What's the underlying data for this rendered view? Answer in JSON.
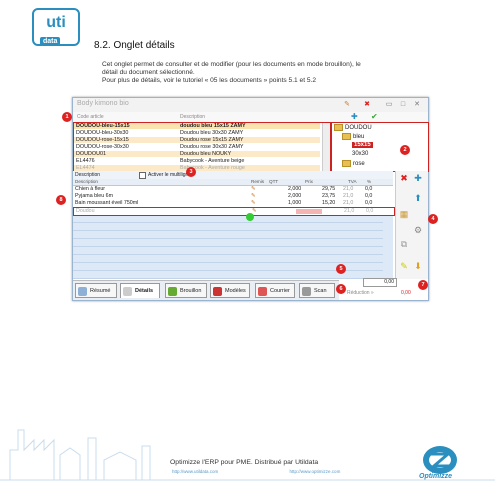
{
  "logo": {
    "main": "uti",
    "sub": "data"
  },
  "doc": {
    "section_title": "8.2. Onglet détails",
    "intro": [
      "Cet onglet permet de consulter et de modifier (pour les documents en mode brouillon), le",
      "détail du document sélectionné.",
      "Pour plus de détails, voir le tutoriel « 05 les documents » points 5.1 et 5.2"
    ]
  },
  "window": {
    "title": "Body kimono bio",
    "search_headers": {
      "code": "Code article",
      "description": "Description"
    },
    "articles": [
      {
        "code": "DOUDOU-bleu-15x15",
        "description": "doudou bleu 15x15 ZAMY"
      },
      {
        "code": "DOUDOU-bleu-30x30",
        "description": "Doudou bleu 30x30 ZAMY"
      },
      {
        "code": "DOUDOU-rose-15x15",
        "description": "Doudou rose 15x15 ZAMY"
      },
      {
        "code": "DOUDOU-rose-30x30",
        "description": "Doudou rose 30x30 ZAMY"
      },
      {
        "code": "DOUDOU01",
        "description": "Doudou bleu NOUKY"
      },
      {
        "code": "EL4476",
        "description": "Babycook - Aventure  beige"
      },
      {
        "code": "EL4474",
        "description": "Babycook - Aventure  rouge"
      }
    ],
    "tree": {
      "root": "DOUDOU",
      "child1": "bleu",
      "leaf1": "15x15",
      "leaf2": "30x30",
      "child2": "rose"
    },
    "filter": {
      "description_label": "Description",
      "checkbox_label": "Activer le multiligne"
    },
    "detail_headers": {
      "description": "Description",
      "remise": "Remis",
      "qty": "QTT",
      "price": "Prix",
      "tva": "TVA",
      "discount": "%"
    },
    "detail_rows": [
      {
        "description": "Chien à fleur",
        "qty": "2,000",
        "price": "29,75",
        "tva": "21,0",
        "discount": "0,0"
      },
      {
        "description": "Pyjama bleu 6m",
        "qty": "2,000",
        "price": "23,75",
        "tva": "21,0",
        "discount": "0,0"
      },
      {
        "description": "Bain moussant éveil 750ml",
        "qty": "1,000",
        "price": "15,20",
        "tva": "21,0",
        "discount": "0,0"
      },
      {
        "description": "Doudou",
        "qty": "",
        "price": "",
        "tva": "21,0",
        "discount": "0,0"
      }
    ],
    "tabs": [
      "Résumé",
      "Détails",
      "Brouillon",
      "Modèles",
      "Courrier",
      "Scan"
    ],
    "totals": {
      "total": "0,00",
      "reduction_label": "Réduction »",
      "reduction_value": "0,00"
    }
  },
  "badges": [
    "1",
    "2",
    "3",
    "4",
    "5",
    "6",
    "7",
    "8"
  ],
  "footer": {
    "text": "Optimizze l'ERP pour PME. Distribué par Utildata",
    "link1": "http://www.utildata.com",
    "link2": "http://www.optimizze.com",
    "brand": "Optimizze"
  },
  "colors": {
    "accent": "#2a8fbf",
    "annotation": "#cc2222",
    "row_highlight": "#fbe9c8"
  }
}
